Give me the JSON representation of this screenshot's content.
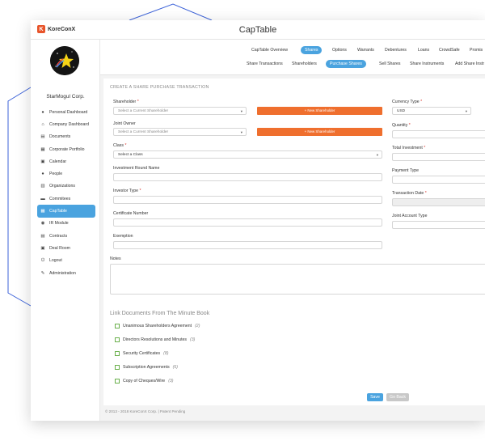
{
  "app": {
    "brand": "KoreConX",
    "logo_letter": "K",
    "title": "CapTable"
  },
  "sidebar": {
    "company": "StarMogul Corp.",
    "items": [
      {
        "label": "Personal Dashboard",
        "icon": "person-icon"
      },
      {
        "label": "Company Dashboard",
        "icon": "home-icon"
      },
      {
        "label": "Documents",
        "icon": "document-icon"
      },
      {
        "label": "Corporate Portfolio",
        "icon": "portfolio-icon"
      },
      {
        "label": "Calendar",
        "icon": "calendar-icon"
      },
      {
        "label": "People",
        "icon": "people-icon"
      },
      {
        "label": "Organizations",
        "icon": "organization-icon"
      },
      {
        "label": "Commitees",
        "icon": "committee-icon"
      },
      {
        "label": "CapTable",
        "icon": "captable-icon",
        "active": true
      },
      {
        "label": "IR Module",
        "icon": "ir-icon"
      },
      {
        "label": "Contracts",
        "icon": "contract-icon"
      },
      {
        "label": "Deal Room",
        "icon": "deal-icon"
      },
      {
        "label": "Logout",
        "icon": "logout-icon"
      },
      {
        "label": "Administration",
        "icon": "wrench-icon"
      }
    ]
  },
  "tabs_row1": [
    "CapTable Overview",
    "Shares",
    "Options",
    "Warrants",
    "Debentures",
    "Loans",
    "CrowdSafe",
    "Promis"
  ],
  "tabs_row1_active": "Shares",
  "tabs_row2": [
    "Share Transactions",
    "Shareholders",
    "Purchase Shares",
    "Sell Shares",
    "Share Instruments",
    "Add Share Instr"
  ],
  "tabs_row2_active": "Purchase Shares",
  "form": {
    "section_title": "CREATE A SHARE PURCHASE TRANSACTION",
    "shareholder_label": "Shareholder",
    "shareholder_placeholder": "Select a Current Shareholder",
    "new_shareholder_btn": "+ New Shareholder",
    "joint_owner_label": "Joint Owner",
    "joint_owner_placeholder": "Select a Current Shareholder",
    "class_label": "Class",
    "class_placeholder": "Select a Class",
    "investment_round_label": "Investment Round Name",
    "investor_type_label": "Investor Type",
    "certificate_label": "Certificate Number",
    "exemption_label": "Exemption",
    "notes_label": "Notes",
    "currency_label": "Currency Type",
    "currency_value": "USD",
    "quantity_label": "Quantity",
    "total_investment_label": "Total Investment",
    "payment_type_label": "Payment Type",
    "transaction_date_label": "Transaction Date",
    "joint_account_label": "Joint Account Type",
    "required_mark": "*",
    "caret": "▾"
  },
  "documents": {
    "title": "Link Documents From The Minute Book",
    "items": [
      {
        "label": "Unanimous Shareholders Agreement",
        "count": "(2)"
      },
      {
        "label": "Directors Resolutions and Minutes",
        "count": "(3)"
      },
      {
        "label": "Security Certificates",
        "count": "(8)"
      },
      {
        "label": "Subscription Agreements",
        "count": "(6)"
      },
      {
        "label": "Copy of Cheques/Wire",
        "count": "(3)"
      }
    ]
  },
  "actions": {
    "save": "Save",
    "back": "Go Back"
  },
  "footer": "© 2013 - 2018 KoreConX Corp. | Patent Pending",
  "colors": {
    "accent": "#4aa3df",
    "orange": "#ef6f2e",
    "check": "#6ab04c"
  }
}
